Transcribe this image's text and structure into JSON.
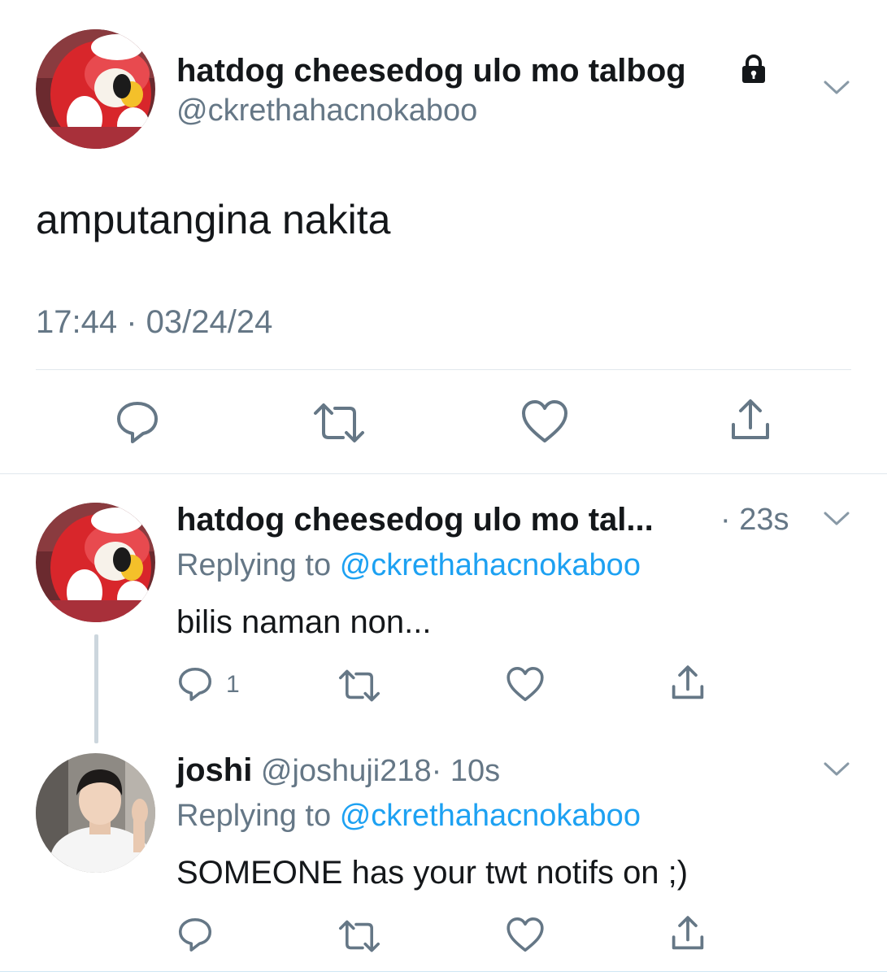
{
  "main_tweet": {
    "display_name": "hatdog cheesedog ulo mo talbog",
    "handle": "@ckrethahacnokaboo",
    "text": "amputangina nakita",
    "timestamp": "17:44 · 03/24/24",
    "protected_icon": "lock-icon",
    "actions": [
      "reply-icon",
      "retweet-icon",
      "like-icon",
      "share-icon"
    ]
  },
  "replies": [
    {
      "display_name": "hatdog cheesedog ulo mo tal...",
      "age": "· 23s",
      "replying_label": "Replying to",
      "replying_handle": "@ckrethahacnokaboo",
      "text": "bilis naman non...",
      "reply_count": "1"
    },
    {
      "display_name": "joshi",
      "handle": "@joshuji218",
      "age": "· 10s",
      "replying_label": "Replying to",
      "replying_handle": "@ckrethahacnokaboo",
      "text": "SOMEONE has your twt notifs on ;)"
    }
  ],
  "colors": {
    "text": "#14171a",
    "secondary": "#657786",
    "link": "#1da1f2",
    "divider": "#e1e8ed",
    "thread_line": "#ccd6dd"
  }
}
